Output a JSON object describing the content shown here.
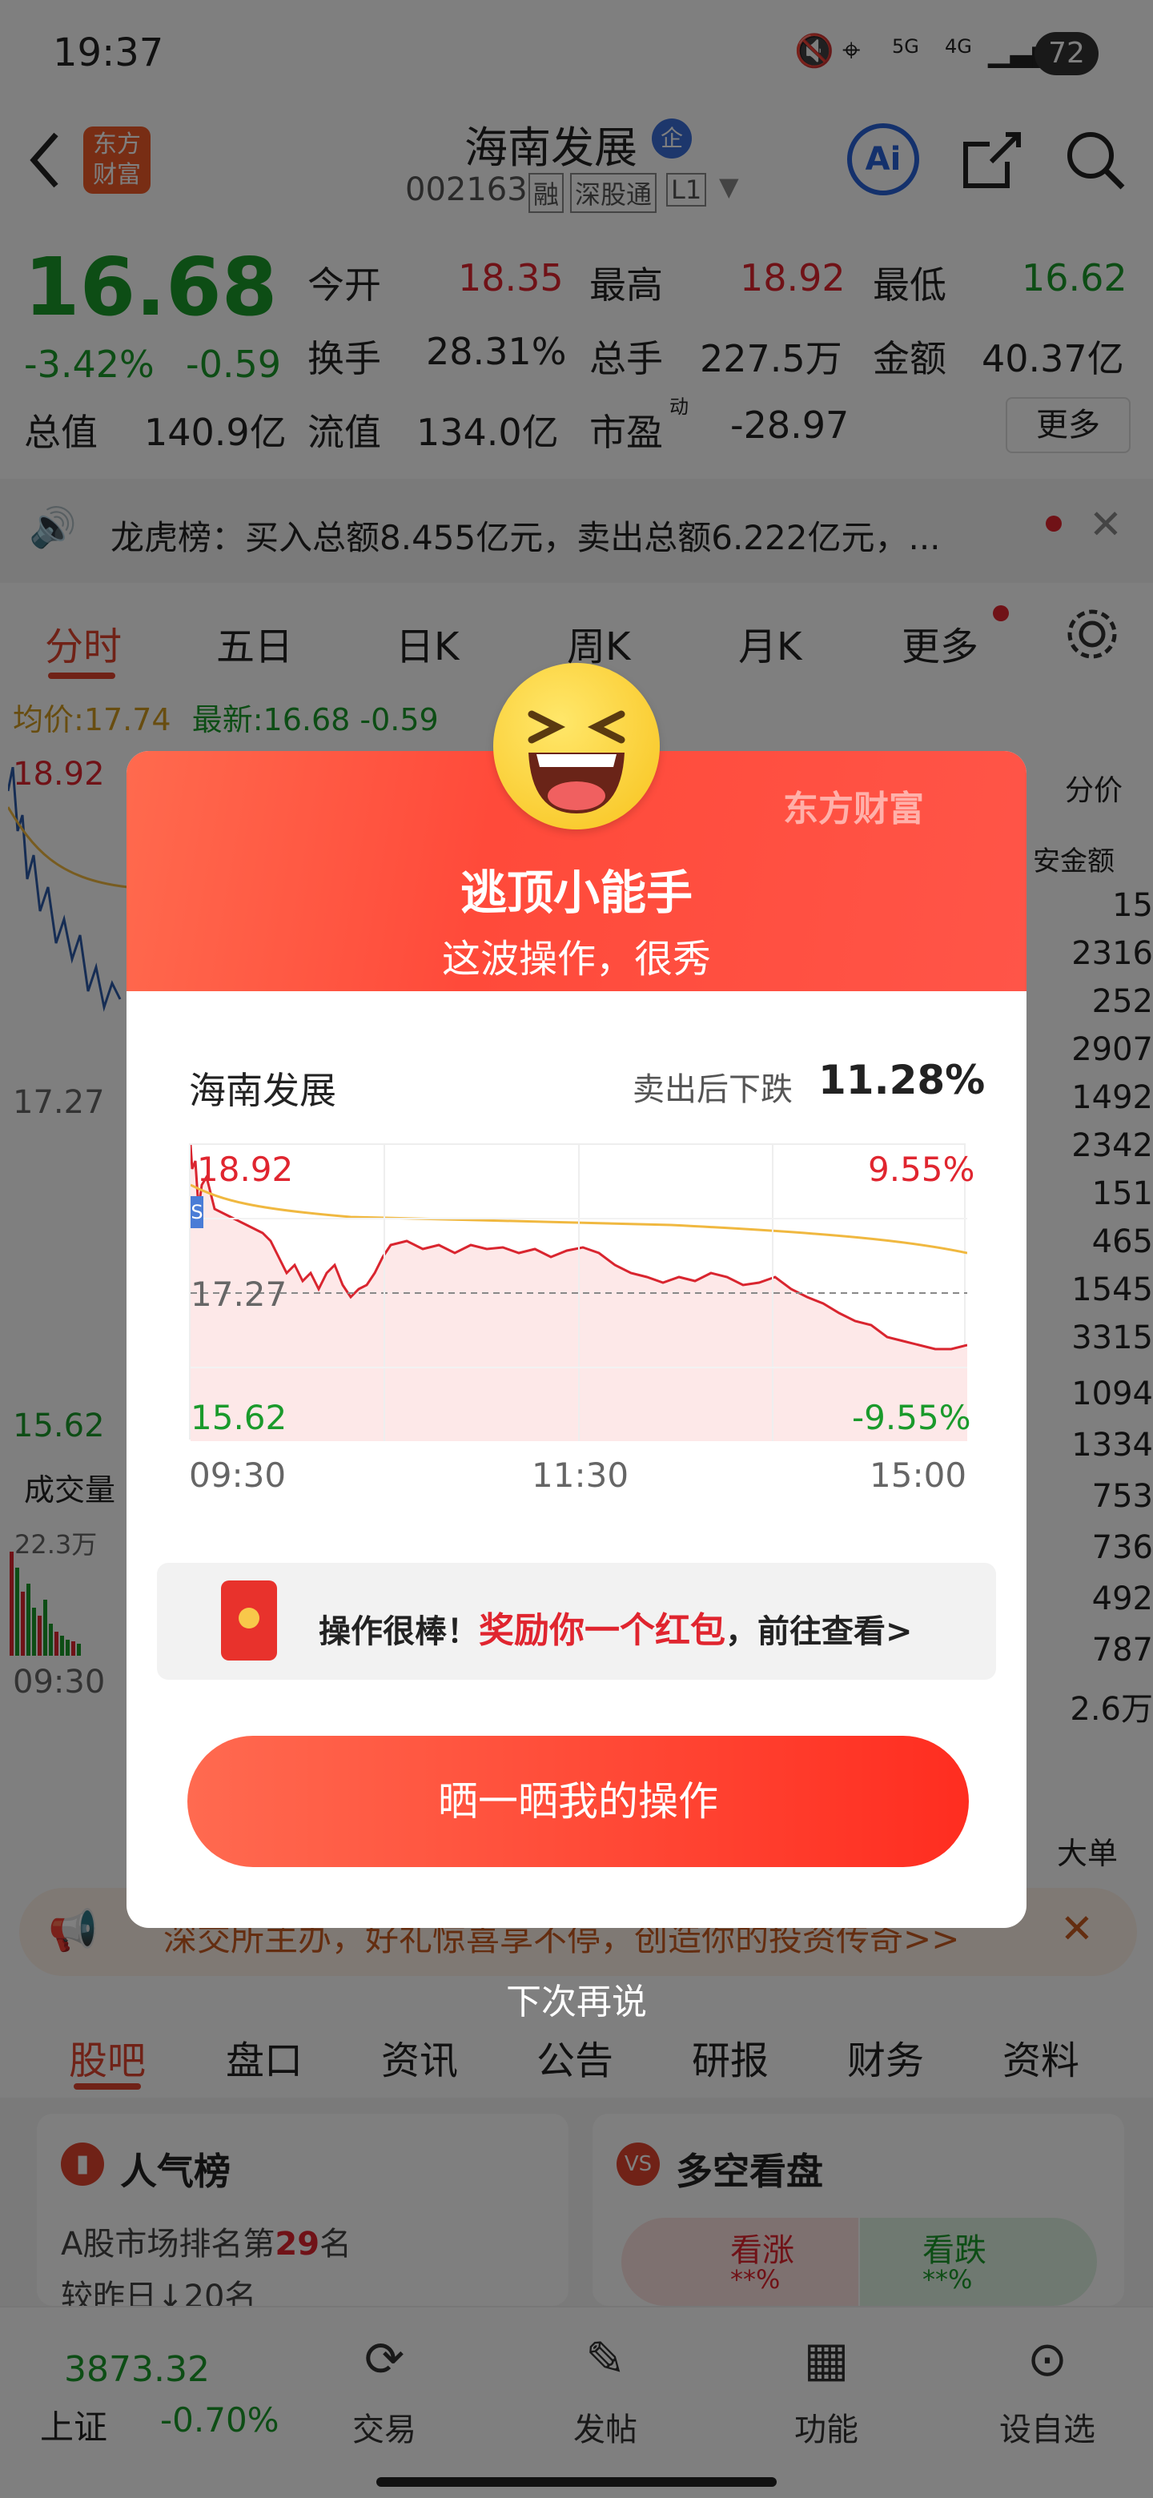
{
  "status": {
    "time": "19:37",
    "battery": "72",
    "net1": "5G",
    "net2": "4G"
  },
  "header": {
    "logo_line1": "东方",
    "logo_line2": "财富",
    "title": "海南发展",
    "badge": "企",
    "code": "002163",
    "tag1": "融",
    "tag2": "深股通",
    "tag3": "L1",
    "ai_label": "Ai"
  },
  "quote": {
    "price": "16.68",
    "change_pct": "-3.42%",
    "change": "-0.59",
    "open_label": "今开",
    "open": "18.35",
    "high_label": "最高",
    "high": "18.92",
    "low_label": "最低",
    "low": "16.62",
    "turnover_label": "换手",
    "turnover": "28.31%",
    "volume_label": "总手",
    "volume": "227.5万",
    "amount_label": "金额",
    "amount": "40.37亿",
    "mcap_label": "总值",
    "mcap": "140.9亿",
    "float_label": "流值",
    "float": "134.0亿",
    "pe_label": "市盈",
    "pe_sup": "动",
    "pe": "-28.97",
    "more_label": "更多"
  },
  "notice": {
    "text": "龙虎榜：买入总额8.455亿元，卖出总额6.222亿元，..."
  },
  "chart_tabs": [
    "分时",
    "五日",
    "日K",
    "周K",
    "月K",
    "更多"
  ],
  "chart_bg": {
    "avg_label": "均价:",
    "avg": "17.74",
    "latest_label": "最新:",
    "latest": "16.68",
    "latest_change": "-0.59",
    "top_price": "18.92",
    "mid_price": "17.27",
    "bottom_price": "15.62",
    "volume_label": "成交量",
    "volume_max": "22.3万",
    "time_start": "09:30",
    "right_header1": "分价",
    "right_header2": "安金额",
    "right_values": [
      "15",
      "2316",
      "252",
      "2907",
      "1492",
      "2342",
      "151",
      "465",
      "1545",
      "3315",
      "1094",
      "1334",
      "753",
      "736",
      "492",
      "787",
      "2.6万"
    ],
    "right_footer": "大单"
  },
  "banner": {
    "text": "深交所主办，好礼惊喜享不停，创造你的投资传奇>>"
  },
  "lower_tabs": [
    "股吧",
    "盘口",
    "资讯",
    "公告",
    "研报",
    "财务",
    "资料"
  ],
  "cards": {
    "popular_title": "人气榜",
    "popular_rank_prefix": "A股市场排名第",
    "popular_rank": "29",
    "popular_rank_suffix": "名",
    "popular_change": "较昨日↓20名",
    "longshort_title": "多空看盘",
    "up_label": "看涨",
    "up_value": "**%",
    "down_label": "看跌",
    "down_value": "**%"
  },
  "bottombar": {
    "index_value": "3873.32",
    "index_name": "上证",
    "index_change": "-0.70%",
    "items": [
      "交易",
      "发帖",
      "功能",
      "设自选"
    ]
  },
  "modal": {
    "brand": "东方财富",
    "title": "逃顶小能手",
    "subtitle": "这波操作，很秀",
    "stock_name": "海南发展",
    "drop_label": "卖出后下跌",
    "drop_value": "11.28%",
    "chart_top_left": "18.92",
    "chart_top_right": "9.55%",
    "chart_mid": "17.27",
    "chart_bottom_left": "15.62",
    "chart_bottom_right": "-9.55%",
    "time_labels": [
      "09:30",
      "11:30",
      "15:00"
    ],
    "reward_prefix": "操作很棒！",
    "reward_highlight": "奖励你一个红包",
    "reward_suffix": "，前往查看>",
    "share_button": "晒一晒我的操作",
    "dismiss": "下次再说"
  },
  "colors": {
    "up": "#e0252f",
    "down": "#1a9a2b",
    "accent": "#ff5040",
    "avg_line": "#f0b840"
  }
}
